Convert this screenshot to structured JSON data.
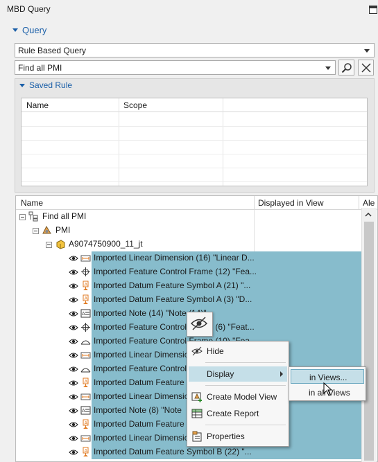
{
  "panel": {
    "title": "MBD Query"
  },
  "query": {
    "header": "Query",
    "type_value": "Rule Based Query",
    "filter_value": "Find all PMI"
  },
  "saved_rule": {
    "header": "Saved Rule",
    "columns": [
      "Name",
      "Scope"
    ]
  },
  "tree": {
    "columns": [
      "Name",
      "Displayed in View",
      "Ale"
    ],
    "root": "Find all PMI",
    "pmi_folder": "PMI",
    "part": "A9074750900_11_jt",
    "items": [
      {
        "icon": "linear-dimension-icon",
        "label": "Imported Linear Dimension (16) \"Linear D..."
      },
      {
        "icon": "feature-control-frame-icon",
        "label": "Imported Feature Control Frame (12) \"Fea..."
      },
      {
        "icon": "datum-feature-symbol-icon",
        "label": "Imported Datum Feature Symbol A (21) \"..."
      },
      {
        "icon": "datum-feature-symbol-icon",
        "label": "Imported Datum Feature Symbol A (3) \"D..."
      },
      {
        "icon": "note-icon",
        "label": "Imported Note (14) \"Note (14)\""
      },
      {
        "icon": "feature-control-frame-icon",
        "label": "Imported Feature Control Frame (6) \"Feat..."
      },
      {
        "icon": "profile-icon",
        "label": "Imported Feature Control Frame (10) \"Fea..."
      },
      {
        "icon": "linear-dimension-icon",
        "label": "Imported Linear Dimensio"
      },
      {
        "icon": "profile-icon",
        "label": "Imported Feature Control"
      },
      {
        "icon": "datum-feature-symbol-icon",
        "label": "Imported Datum Feature"
      },
      {
        "icon": "linear-dimension-icon",
        "label": "Imported Linear Dimensio"
      },
      {
        "icon": "note-icon",
        "label": "Imported Note (8) \"Note"
      },
      {
        "icon": "datum-feature-symbol-icon",
        "label": "Imported Datum Feature"
      },
      {
        "icon": "linear-dimension-icon",
        "label": "Imported Linear Dimensio"
      },
      {
        "icon": "datum-feature-symbol-icon",
        "label": "Imported Datum Feature Symbol B (22) \"..."
      }
    ]
  },
  "context_menu": {
    "hide": "Hide",
    "display": "Display",
    "create_model_view": "Create Model View",
    "create_report": "Create Report",
    "properties": "Properties"
  },
  "submenu": {
    "in_views": "in Views...",
    "in_all_views": "in all Views"
  },
  "colors": {
    "accent": "#1a5fa8",
    "selection": "#87bccc",
    "menu_highlight": "#c5dfe8"
  }
}
